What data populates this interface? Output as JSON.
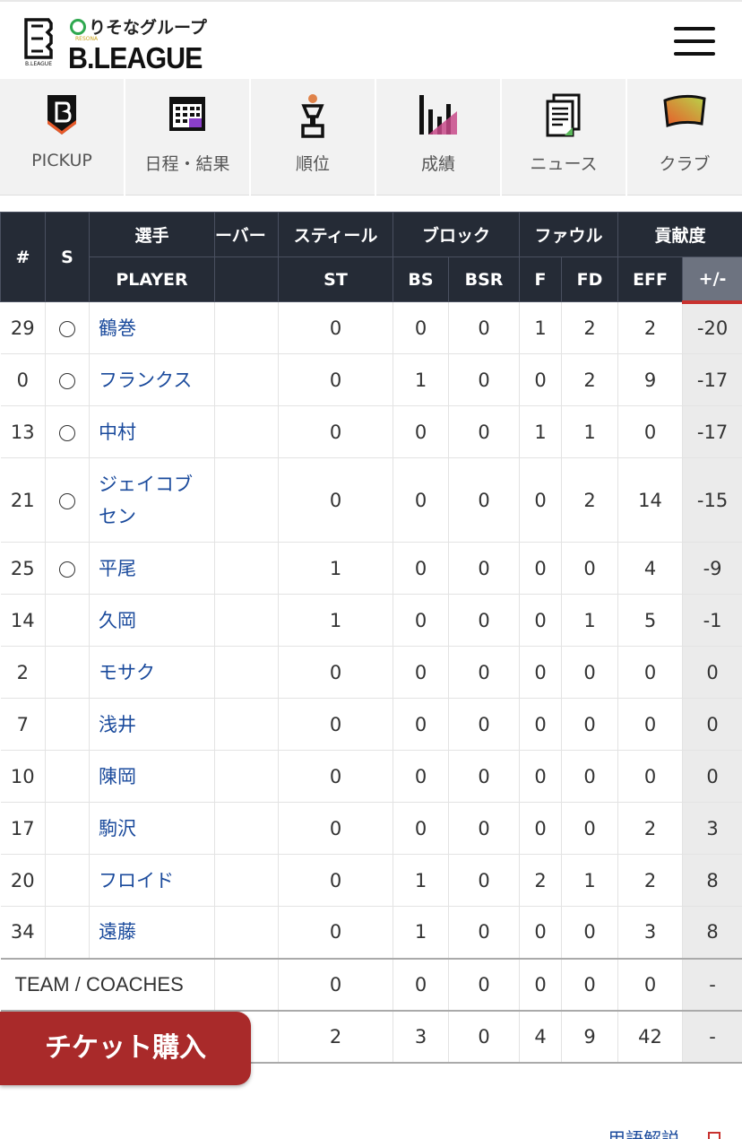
{
  "header": {
    "sponsor": "りそなグループ",
    "sponsor_sub": "RESONA",
    "brand": "B.LEAGUE",
    "logo_sub": "B.LEAGUE",
    "menu_icon": "hamburger-icon"
  },
  "nav": [
    {
      "label": "PICKUP",
      "icon": "pickup-icon"
    },
    {
      "label": "日程・結果",
      "icon": "calendar-icon"
    },
    {
      "label": "順位",
      "icon": "trophy-icon"
    },
    {
      "label": "成績",
      "icon": "bar-chart-icon"
    },
    {
      "label": "ニュース",
      "icon": "news-icon"
    },
    {
      "label": "クラブ",
      "icon": "flag-icon"
    }
  ],
  "table": {
    "group_headers": {
      "num": "#",
      "start": "S",
      "player": "選手",
      "turnover": "ーバー",
      "steal": "スティール",
      "block": "ブロック",
      "foul": "ファウル",
      "contrib": "貢献度"
    },
    "sub_headers": {
      "player": "PLAYER",
      "st": "ST",
      "bs": "BS",
      "bsr": "BSR",
      "f": "F",
      "fd": "FD",
      "eff": "EFF",
      "pm": "+/-"
    },
    "rows": [
      {
        "num": "29",
        "start": true,
        "player": "鶴巻",
        "st": "0",
        "bs": "0",
        "bsr": "0",
        "f": "1",
        "fd": "2",
        "eff": "2",
        "pm": "-20"
      },
      {
        "num": "0",
        "start": true,
        "player": "フランクス",
        "st": "0",
        "bs": "1",
        "bsr": "0",
        "f": "0",
        "fd": "2",
        "eff": "9",
        "pm": "-17"
      },
      {
        "num": "13",
        "start": true,
        "player": "中村",
        "st": "0",
        "bs": "0",
        "bsr": "0",
        "f": "1",
        "fd": "1",
        "eff": "0",
        "pm": "-17"
      },
      {
        "num": "21",
        "start": true,
        "player": "ジェイコブセン",
        "st": "0",
        "bs": "0",
        "bsr": "0",
        "f": "0",
        "fd": "2",
        "eff": "14",
        "pm": "-15"
      },
      {
        "num": "25",
        "start": true,
        "player": "平尾",
        "st": "1",
        "bs": "0",
        "bsr": "0",
        "f": "0",
        "fd": "0",
        "eff": "4",
        "pm": "-9"
      },
      {
        "num": "14",
        "start": false,
        "player": "久岡",
        "st": "1",
        "bs": "0",
        "bsr": "0",
        "f": "0",
        "fd": "1",
        "eff": "5",
        "pm": "-1"
      },
      {
        "num": "2",
        "start": false,
        "player": "モサク",
        "st": "0",
        "bs": "0",
        "bsr": "0",
        "f": "0",
        "fd": "0",
        "eff": "0",
        "pm": "0"
      },
      {
        "num": "7",
        "start": false,
        "player": "浅井",
        "st": "0",
        "bs": "0",
        "bsr": "0",
        "f": "0",
        "fd": "0",
        "eff": "0",
        "pm": "0"
      },
      {
        "num": "10",
        "start": false,
        "player": "陳岡",
        "st": "0",
        "bs": "0",
        "bsr": "0",
        "f": "0",
        "fd": "0",
        "eff": "0",
        "pm": "0"
      },
      {
        "num": "17",
        "start": false,
        "player": "駒沢",
        "st": "0",
        "bs": "0",
        "bsr": "0",
        "f": "0",
        "fd": "0",
        "eff": "2",
        "pm": "3"
      },
      {
        "num": "20",
        "start": false,
        "player": "フロイド",
        "st": "0",
        "bs": "1",
        "bsr": "0",
        "f": "2",
        "fd": "1",
        "eff": "2",
        "pm": "8"
      },
      {
        "num": "34",
        "start": false,
        "player": "遠藤",
        "st": "0",
        "bs": "1",
        "bsr": "0",
        "f": "0",
        "fd": "0",
        "eff": "3",
        "pm": "8"
      }
    ],
    "team_row": {
      "label": "TEAM / COACHES",
      "st": "0",
      "bs": "0",
      "bsr": "0",
      "f": "0",
      "fd": "0",
      "eff": "0",
      "pm": "-"
    },
    "total_row": {
      "st": "2",
      "bs": "3",
      "bsr": "0",
      "f": "4",
      "fd": "9",
      "eff": "42",
      "pm": "-"
    }
  },
  "ticket_button": "チケット購入",
  "glossary_link": "用語解説",
  "colors": {
    "header_dark": "#252b36",
    "accent_red": "#c8322f",
    "ticket_red": "#a92a2a",
    "link_blue": "#1a4a9c"
  }
}
